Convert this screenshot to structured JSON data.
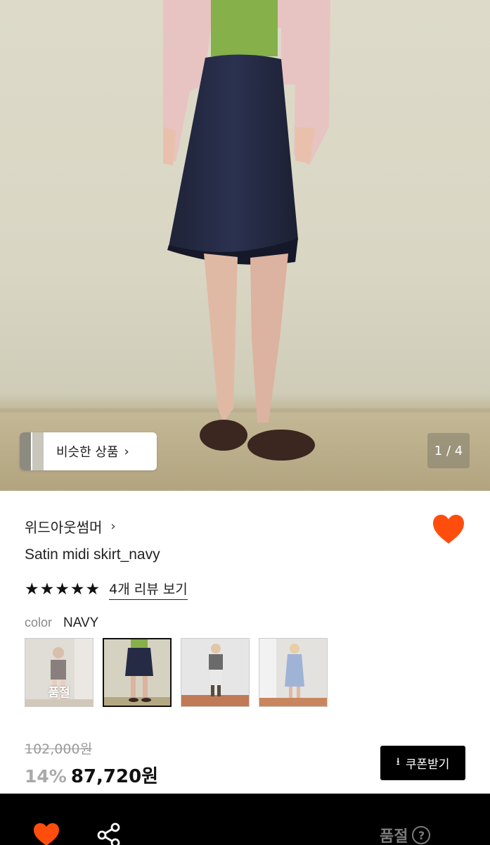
{
  "gallery": {
    "similar_label": "비슷한 상품",
    "similar_chevron": "›",
    "counter": "1 / 4"
  },
  "product": {
    "brand": "위드아웃썸머",
    "brand_chevron": "›",
    "title": "Satin midi skirt_navy",
    "stars": [
      "★",
      "★",
      "★",
      "★",
      "★"
    ],
    "review_link": "4개 리뷰 보기",
    "wishlist_icon": "heart-icon",
    "accent_color": "#ff4d0d"
  },
  "options": {
    "color_label": "color",
    "color_value": "NAVY",
    "swatches": [
      {
        "name": "swatch-1",
        "soldout_label": "품절"
      },
      {
        "name": "swatch-2"
      },
      {
        "name": "swatch-3"
      },
      {
        "name": "swatch-4"
      }
    ]
  },
  "pricing": {
    "original": "102,000원",
    "discount": "14%",
    "final": "87,720원",
    "coupon_label": "쿠폰받기",
    "coupon_icon": "download-icon"
  },
  "bottom_bar": {
    "heart_icon": "heart-icon",
    "share_icon": "share-icon",
    "soldout_label": "품절",
    "help_glyph": "?"
  }
}
